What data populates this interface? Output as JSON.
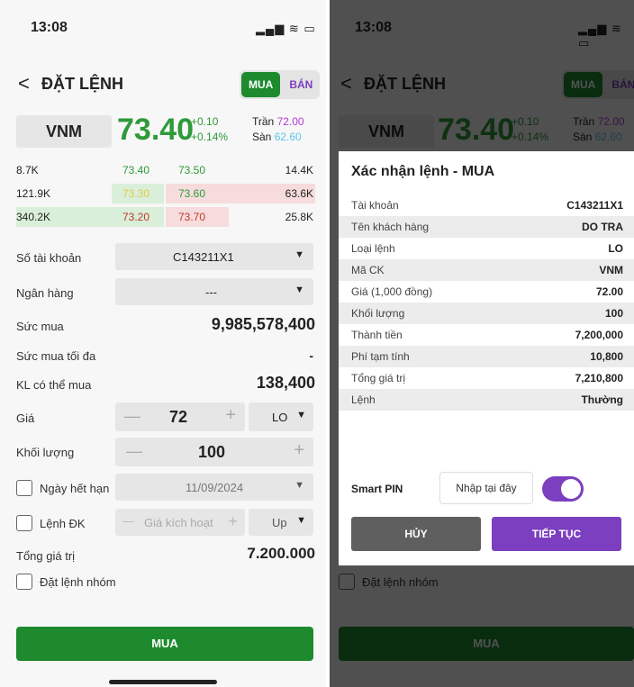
{
  "left": {
    "status": {
      "time": "13:08",
      "icons": "▂▄▆ ≋ ▭"
    },
    "header": {
      "back": "<",
      "title": "ĐẶT LỆNH",
      "buy": "MUA",
      "sell": "BÁN"
    },
    "quote": {
      "symbol": "VNM",
      "price": "73.40",
      "change": "+0.10",
      "change_pct": "+0.14%",
      "ceil_label": "Trần",
      "ceil": "72.00",
      "floor_label": "Sàn",
      "floor": "62.60"
    },
    "orderbook": [
      {
        "bid_vol": "8.7K",
        "bid": "73.40",
        "ask": "73.50",
        "ask_vol": "14.4K"
      },
      {
        "bid_vol": "121.9K",
        "bid": "73.30",
        "ask": "73.60",
        "ask_vol": "63.6K"
      },
      {
        "bid_vol": "340.2K",
        "bid": "73.20",
        "ask": "73.70",
        "ask_vol": "25.8K"
      }
    ],
    "form": {
      "account_label": "Số tài khoản",
      "account": "C143211X1",
      "bank_label": "Ngân hàng",
      "bank": "---",
      "power_label": "Sức mua",
      "power": "9,985,578,400",
      "power_max_label": "Sức mua tối đa",
      "power_max": "-",
      "kl_label": "KL có thể mua",
      "kl": "138,400",
      "price_label": "Giá",
      "price": "72",
      "order_type": "LO",
      "qty_label": "Khối lượng",
      "qty": "100",
      "expiry_label": "Ngày hết hạn",
      "expiry": "11/09/2024",
      "cond_label": "Lệnh ĐK",
      "trigger_ph": "Giá kích hoạt",
      "dir": "Up",
      "total_label": "Tổng giá trị",
      "total": "7.200.000",
      "group_label": "Đặt lệnh nhóm"
    },
    "submit": "MUA"
  },
  "right": {
    "modal": {
      "title": "Xác nhận lệnh - MUA",
      "rows": [
        {
          "k": "Tài khoản",
          "v": "C143211X1"
        },
        {
          "k": "Tên khách hàng",
          "v": "DO TRA"
        },
        {
          "k": "Loại lệnh",
          "v": "LO"
        },
        {
          "k": "Mã CK",
          "v": "VNM"
        },
        {
          "k": "Giá (1,000 đồng)",
          "v": "72.00"
        },
        {
          "k": "Khối lượng",
          "v": "100"
        },
        {
          "k": "Thành tiền",
          "v": "7,200,000"
        },
        {
          "k": "Phí tạm tính",
          "v": "10,800"
        },
        {
          "k": "Tổng giá trị",
          "v": "7,210,800"
        },
        {
          "k": "Lệnh",
          "v": "Thường"
        }
      ],
      "pin_label": "Smart PIN",
      "pin_placeholder": "Nhập tại đây",
      "cancel": "HỦY",
      "continue": "TIẾP TỤC"
    }
  },
  "colors": {
    "green": "#1e8a2e",
    "purple": "#7b3fbf",
    "ceil": "#b43cd4",
    "floor": "#5bc6e8"
  }
}
